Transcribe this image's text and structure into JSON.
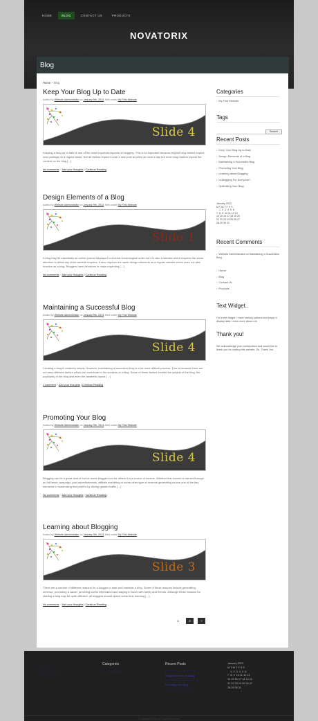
{
  "nav": [
    "HOME",
    "BLOG",
    "CONTACT US",
    "PRODUCTS"
  ],
  "site_title": "NOVATORIX",
  "page_title": "Blog",
  "breadcrumb": {
    "home": "Home",
    "sep": " » ",
    "current": "Blog"
  },
  "meta_labels": {
    "added_by": "Added by",
    "on": "on",
    "filed": ", filed under"
  },
  "posts": [
    {
      "title": "Keep Your Blog Up to Date",
      "author": "Website Administrator",
      "date": "January 9th, 2013",
      "category": "My First Website",
      "slide": "Slide 4",
      "excerpt": "Keeping a blog up to date is one of the most important aspects of blogging. This is so important because regular blog visitors expect new postings on a regular basis. Not all visitors expect to see a new post as often as once a day but most blog readers expect the content on the blog […]",
      "comments": "No comments",
      "thoughts": "Add your thoughts",
      "more": "Continue Reading"
    },
    {
      "title": "Design Elements of a Blog",
      "author": "Website Administrator",
      "date": "January 9th, 2013",
      "category": "My First Website",
      "slide": "Slide 1",
      "excerpt": "A blog may be essentially an online journal displayed in reverse chronological order but it is also a website which requires the same attention to detail any other website requires. It also requires the same design elements as a regular website which does not also function as a blog. Bloggers have decisions to make regarding […]",
      "comments": "No comments",
      "thoughts": "Add your thoughts",
      "more": "Continue Reading"
    },
    {
      "title": "Maintaining a Successful Blog",
      "author": "Website Administrator",
      "date": "January 9th, 2013",
      "category": "My First Website",
      "slide": "Slide 4",
      "excerpt": "Creating a blog is relatively simply. However, maintaining a successful blog is a far more difficult process. This is because there are so many different factors which can contribute to the success of a blog. Some of these factors include the subject of the blog, the popularity of the blog and even the aesthetic layout […]",
      "comments": "1 comment",
      "thoughts": "Add your thoughts",
      "more": "Continue Reading"
    },
    {
      "title": "Promoting Your Blog",
      "author": "Website Administrator",
      "date": "January 9th, 2013",
      "category": "My First Website",
      "slide": "Slide 4",
      "excerpt": "Blogging can be a great deal of fun for some bloggers but for others it is a source of income. Whether this income is earned through an AdSense campaign, paid advertisements, affiliate marketing or some other type of revenue generating source one of the key elements to maximizing this profit is by driving greater traffic […]",
      "comments": "No comments",
      "thoughts": "Add your thoughts",
      "more": "Continue Reading"
    },
    {
      "title": "Learning about Blogging",
      "author": "Website Administrator",
      "date": "January 9th, 2013",
      "category": "My First Website",
      "slide": "Slide 3",
      "excerpt": "There are a number of different reasons for a blogger to start and maintain a blog. Some of these reasons include generating revenue, promoting a cause, providing useful information and staying in touch with family and friends. Although these reasons for starting a blog may be quite different, all bloggers should spend some time learning […]",
      "comments": "No comments",
      "thoughts": "Add your thoughts",
      "more": "Continue Reading"
    }
  ],
  "slide_colors": {
    "Slide 4": "#d9c94a",
    "Slide 1": "#8a2a1a",
    "Slide 3": "#c36a18"
  },
  "pagination": [
    "1",
    "2",
    "»"
  ],
  "sidebar": {
    "categories_title": "Categories",
    "categories": [
      "My First Website"
    ],
    "tags_title": "Tags",
    "search_label": "Search",
    "recent_posts_title": "Recent Posts",
    "recent_posts": [
      "Keep Your Blog Up to Date",
      "Design Elements of a Blog",
      "Maintaining a Successful Blog",
      "Promoting Your Blog",
      "Learning about Blogging",
      "Is Blogging For Everyone?",
      "Optimizing Your Blog"
    ],
    "calendar": "January 2013\nM T W T F S S\n    1  2  3  4  5  6\n7  8  9  10 11 12 13\n14 15 16 17 18 19 20\n21 22 23 24 25 26 27\n28 29 30 31",
    "recent_comments_title": "Recent Comments",
    "recent_comment": "Website Administrator on Maintaining a Successful Blog",
    "pages": [
      "Home",
      "Blog",
      "Contact Us",
      "Products"
    ],
    "text_widget_title": "Text Widget..",
    "text_widget_body": "I'm a text widget. I have various options and ways to display data. Learn more about me.",
    "thanks_title": "Thank you!",
    "thanks_body": "We acknowledge your participation and would like to thank you for visiting this website. So, Thank You."
  },
  "footer": {
    "col1_links": [
      "Home Page",
      "Privacy Policy",
      "Terms & Conditions"
    ],
    "categories_title": "Categories",
    "categories": [
      "My First Website"
    ],
    "recent_posts_title": "Recent Posts",
    "recent_posts": [
      "Keep Your Blog Up to Date",
      "Design Elements of a Blog",
      "Maintaining a Successful Blog",
      "Promoting Your Blog",
      "Learning about Blogging"
    ],
    "calendar": "January 2013\nM T W T F S S\n    1  2  3  4  5  6\n7  8  9  10 11 12 13\n14 15 16 17 18 19 20\n21 22 23 24 25 26 27\n28 29 30 31",
    "copyright": "© Copyright 2016. All Rights Reserved."
  }
}
